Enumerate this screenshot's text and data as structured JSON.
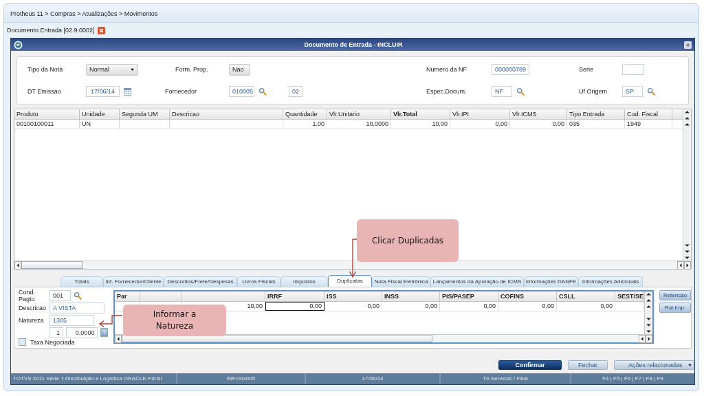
{
  "breadcrumb": "Protheus 11 > Compras  > Atualizações > Movimentos",
  "document_tab": {
    "label": "Documento Entrada [02.9.0002]"
  },
  "dialog": {
    "title": "Documento de Entrada - INCLUIR"
  },
  "form": {
    "rows": [
      [
        {
          "label": "Tipo da Nota",
          "kind": "select",
          "value": "Normal"
        },
        {
          "label": "Form. Prop.",
          "kind": "select",
          "value": "Nao"
        },
        {
          "label": "Numero da NF",
          "kind": "input",
          "value": "000000789"
        },
        {
          "label": "Serie",
          "kind": "input"
        }
      ],
      [
        {
          "label": "DT Emissao",
          "kind": "date",
          "value": "17/06/14"
        },
        {
          "label": "Fornecedor",
          "kind": "lookup",
          "value": "010005",
          "extra": "02"
        },
        {
          "label": "Espec.Docum.",
          "kind": "lookup",
          "value": "NF"
        },
        {
          "label": "Uf.Origem",
          "kind": "lookup",
          "value": "SP"
        }
      ]
    ]
  },
  "items_table": {
    "columns": [
      {
        "label": "Produto",
        "bold": false
      },
      {
        "label": "Unidade",
        "bold": false
      },
      {
        "label": "Segunda UM",
        "bold": false
      },
      {
        "label": "Descricao",
        "bold": false
      },
      {
        "label": "Quantidade",
        "bold": false
      },
      {
        "label": "Vlr.Unitario",
        "bold": false
      },
      {
        "label": "Vlr.Total",
        "bold": true
      },
      {
        "label": "Vlr.IPI",
        "bold": false
      },
      {
        "label": "Vlr.ICMS",
        "bold": false
      },
      {
        "label": "Tipo Entrada",
        "bold": false
      },
      {
        "label": "Cod. Fiscal",
        "bold": false
      }
    ],
    "rows": [
      [
        "00100100011",
        "UN",
        null,
        null,
        "1,00",
        "10,0000",
        "10,00",
        "0,00",
        "0,00",
        "035",
        "1949"
      ]
    ]
  },
  "tabs": [
    {
      "label": "Totais",
      "selected": false
    },
    {
      "label": "Inf. Fornecedor/Cliente",
      "selected": false
    },
    {
      "label": "Descontos/Frete/Despesas",
      "selected": false
    },
    {
      "label": "Livros Fiscais",
      "selected": false
    },
    {
      "label": "Impostos",
      "selected": false
    },
    {
      "label": "Duplicatas",
      "selected": true
    },
    {
      "label": "Nota Fiscal Eletrônica",
      "selected": false
    },
    {
      "label": "Lançamentos da Apuração de ICMS",
      "selected": false
    },
    {
      "label": "Informações DANFE",
      "selected": false
    },
    {
      "label": "Informações Adicionais",
      "selected": false
    }
  ],
  "payment": {
    "cond_label": "Cond. Pagto",
    "cond_value": "001",
    "desc_label": "Descricao",
    "desc_value": "A VISTA",
    "natureza_label": "Natureza",
    "natureza_value": "1305",
    "currency": "1",
    "rate": "0,0000",
    "help": "?",
    "taxa_label": "Taxa Negociada",
    "taxa_checked": false
  },
  "installments_table": {
    "columns": [
      {
        "label": "Par"
      },
      {},
      {},
      {
        "label": "IRRF"
      },
      {
        "label": "ISS"
      },
      {
        "label": "INSS"
      },
      {
        "label": "PIS/PASEP"
      },
      {
        "label": "COFINS"
      },
      {
        "label": "CSLL"
      },
      {
        "label": "SEST/SE"
      }
    ],
    "rows": [
      [
        {
          "focused": false
        },
        {
          "focused": false
        },
        {
          "text": "10,00",
          "focused": false
        },
        {
          "text": "0,00",
          "focused": true
        },
        {
          "text": "0,00",
          "focused": false
        },
        {
          "text": "0,00",
          "focused": false
        },
        {
          "text": "0,00",
          "focused": false
        },
        {
          "text": "0,00",
          "focused": false
        },
        {
          "text": "0,00",
          "focused": false
        },
        {
          "focused": false
        }
      ]
    ]
  },
  "side_buttons": [
    "Retencao",
    "Rat.Imp."
  ],
  "buttons": [
    {
      "label": "Confirmar",
      "kind": "primary"
    },
    {
      "label": "Fechar",
      "kind": "normal"
    },
    {
      "label": "Ações relacionadas",
      "kind": "menu"
    }
  ],
  "status_bar": [
    "TOTVS 2011 Série T Distribuição e Logística ORACLE Partsl",
    "INFO03005",
    "17/06/14",
    "Tb Servicos / Filial",
    "F4 | F5 | F6 | F7 | F8 | F9"
  ],
  "callouts": {
    "tab_note": "Clicar Duplicadas",
    "field_note": "Informar a Natureza"
  }
}
